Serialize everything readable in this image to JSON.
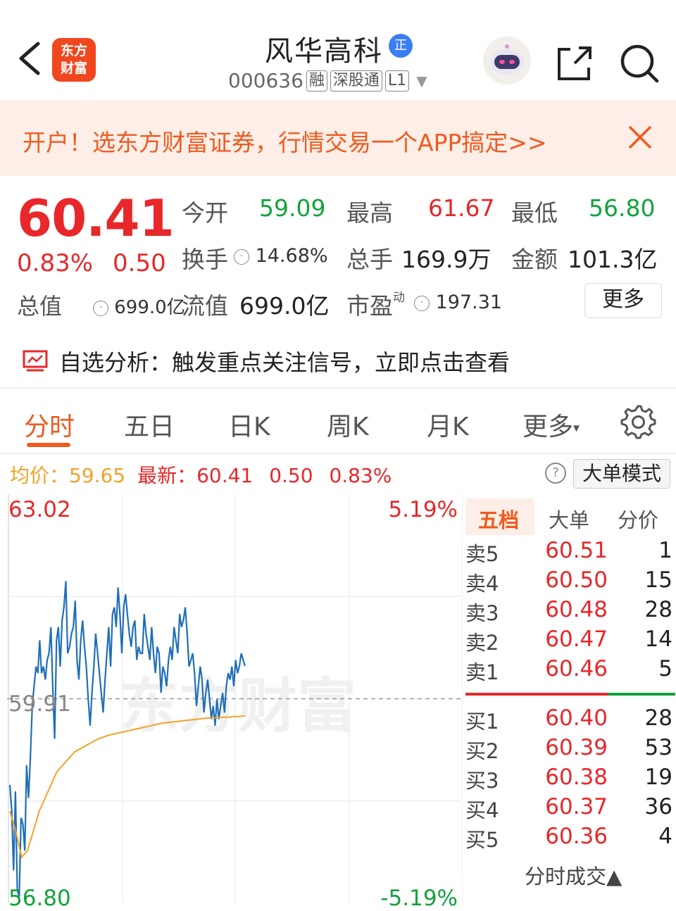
{
  "header": {
    "logo_line1": "东方",
    "logo_line2": "财富",
    "stock_name": "风华高科",
    "badge": "正",
    "stock_code": "000636",
    "tag_margin": "融",
    "tag_connect": "深股通",
    "tag_level": "L1",
    "dropdown_icon": "▼"
  },
  "banner": {
    "text": "开户！选东方财富证券，行情交易一个APP搞定>>"
  },
  "quote": {
    "price": "60.41",
    "change_pct": "0.83%",
    "change_amt": "0.50",
    "total_value_label": "总值",
    "total_value": "699.0亿",
    "open_label": "今开",
    "open": "59.09",
    "high_label": "最高",
    "high": "61.67",
    "low_label": "最低",
    "low": "56.80",
    "turnover_label": "换手",
    "turnover": "14.68%",
    "volume_label": "总手",
    "volume": "169.9万",
    "amount_label": "金额",
    "amount": "101.3亿",
    "float_label": "流值",
    "float": "699.0亿",
    "pe_label": "市盈",
    "pe_sup": "动",
    "pe": "197.31",
    "more_label": "更多"
  },
  "analysis": {
    "text": "自选分析：触发重点关注信号，立即点击查看"
  },
  "tabs": [
    {
      "label": "分时",
      "active": true
    },
    {
      "label": "五日",
      "active": false
    },
    {
      "label": "日K",
      "active": false
    },
    {
      "label": "周K",
      "active": false
    },
    {
      "label": "月K",
      "active": false
    },
    {
      "label": "更多",
      "active": false
    }
  ],
  "avg_bar": {
    "avg_label": "均价：",
    "avg_value": "59.65",
    "latest_label": "最新：",
    "latest_value": "60.41",
    "latest_change": "0.50",
    "latest_pct": "0.83%",
    "help_icon": "?",
    "big_order_label": "大单模式"
  },
  "chart_data": {
    "type": "line",
    "y_max_label": "63.02",
    "y_min_label": "56.80",
    "prev_close_label": "59.91",
    "pct_max_label": "5.19%",
    "pct_min_label": "-5.19%",
    "ylim": [
      56.8,
      63.02
    ],
    "prev_close": 59.91,
    "watermark": "东方财富",
    "series": [
      {
        "colors": "#1f6fb8",
        "values": [
          58.6,
          58.2,
          57.3,
          58.5,
          57.0,
          56.9,
          58.1,
          58.0,
          57.6,
          58.9,
          58.4,
          59.0,
          59.8,
          60.1,
          60.4,
          60.3,
          60.8,
          60.3,
          60.4,
          60.2,
          60.5,
          60.6,
          61.0,
          60.1,
          59.3,
          60.8,
          61.0,
          60.4,
          61.1,
          61.3,
          61.7,
          60.6,
          60.7,
          60.9,
          61.0,
          61.4,
          60.5,
          60.2,
          60.8,
          61.1,
          60.7,
          60.4,
          59.9,
          59.5,
          60.0,
          60.4,
          60.9,
          60.6,
          60.3,
          60.0,
          59.7,
          60.2,
          60.6,
          61.0,
          60.4,
          61.2,
          61.3,
          61.0,
          61.6,
          61.2,
          60.6,
          61.3,
          61.5,
          61.2,
          60.9,
          60.7,
          61.0,
          61.1,
          60.5,
          60.7,
          60.6,
          60.6,
          61.2,
          60.9,
          60.7,
          60.5,
          61.0,
          60.6,
          60.3,
          60.7,
          60.6,
          60.0,
          60.4,
          60.3,
          60.1,
          60.5,
          60.7,
          60.5,
          61.0,
          60.8,
          60.6,
          61.2,
          61.0,
          61.1,
          61.3,
          60.9,
          60.4,
          60.5,
          60.6,
          60.3,
          59.8,
          60.1,
          60.4,
          60.2,
          59.7,
          60.0,
          60.2,
          59.9,
          59.6,
          59.8,
          59.5,
          59.9,
          59.6,
          59.8,
          60.0,
          59.7,
          60.1,
          60.3,
          60.2,
          60.4,
          60.1,
          60.5,
          60.3,
          60.4,
          60.6,
          60.5,
          60.41
        ]
      },
      {
        "colors": "#f2a227",
        "values": [
          58.2,
          57.9,
          57.5,
          57.6,
          57.9,
          58.2,
          58.4,
          58.6,
          58.8,
          58.9,
          59.0,
          59.1,
          59.15,
          59.2,
          59.25,
          59.3,
          59.33,
          59.36,
          59.38,
          59.4,
          59.42,
          59.44,
          59.46,
          59.48,
          59.5,
          59.52,
          59.54,
          59.55,
          59.56,
          59.57,
          59.58,
          59.59,
          59.6,
          59.61,
          59.62,
          59.62,
          59.63,
          59.63,
          59.64,
          59.64,
          59.65
        ]
      }
    ]
  },
  "orderbook": {
    "tabs": [
      "五档",
      "大单",
      "分价"
    ],
    "sell": [
      {
        "label": "卖5",
        "price": "60.51",
        "vol": "1"
      },
      {
        "label": "卖4",
        "price": "60.50",
        "vol": "15"
      },
      {
        "label": "卖3",
        "price": "60.48",
        "vol": "28"
      },
      {
        "label": "卖2",
        "price": "60.47",
        "vol": "14"
      },
      {
        "label": "卖1",
        "price": "60.46",
        "vol": "5"
      }
    ],
    "buy": [
      {
        "label": "买1",
        "price": "60.40",
        "vol": "28"
      },
      {
        "label": "买2",
        "price": "60.39",
        "vol": "53"
      },
      {
        "label": "买3",
        "price": "60.38",
        "vol": "19"
      },
      {
        "label": "买4",
        "price": "60.37",
        "vol": "36"
      },
      {
        "label": "买5",
        "price": "60.36",
        "vol": "4"
      }
    ],
    "footer": "分时成交▲"
  }
}
